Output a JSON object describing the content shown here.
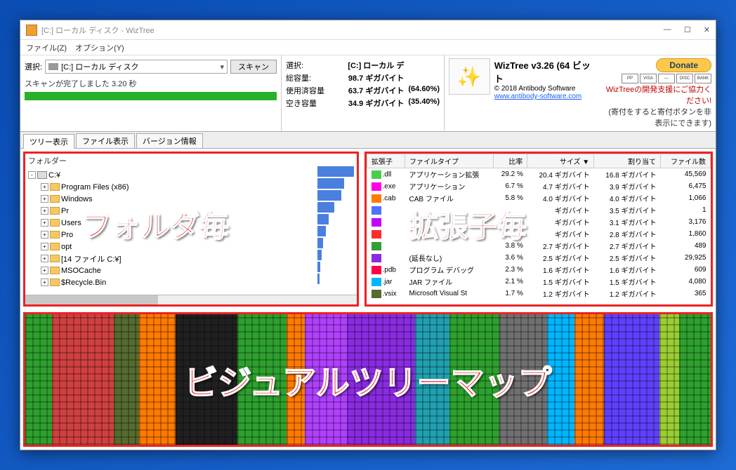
{
  "title": "[C:] ローカル ディスク  - WizTree",
  "menu": {
    "file": "ファイル(Z)",
    "options": "オプション(Y)"
  },
  "select_label": "選択:",
  "drive_combo": "[C:] ローカル ディスク",
  "scan_btn": "スキャン",
  "scan_done": "スキャンが完了しました 3.20 秒",
  "info": {
    "sel_label": "選択:",
    "sel_val": "[C:] ローカル デ",
    "total_label": "総容量:",
    "total_val": "98.7 ギガバイト",
    "used_label": "使用済容量",
    "used_val": "63.7 ギガバイト",
    "used_pct": "(64.60%)",
    "free_label": "空き容量",
    "free_val": "34.9 ギガバイト",
    "free_pct": "(35.40%)"
  },
  "brand": {
    "title": "WizTree v3.26 (64 ビット",
    "copyright": "© 2018 Antibody Software",
    "url": "www.antibody-software.com"
  },
  "donate": {
    "btn": "Donate",
    "line1": "WizTreeの開発支援にご協力ください!",
    "line2": "(寄付をすると寄付ボタンを非表示にできます)",
    "cc": [
      "PP",
      "VISA",
      "—",
      "DISC",
      "BANK"
    ]
  },
  "tabs": {
    "tree": "ツリー表示",
    "files": "ファイル表示",
    "version": "バージョン情報"
  },
  "folder_header": "フォルダー",
  "tree": [
    {
      "exp": "-",
      "icon": "drive",
      "label": "C:¥"
    },
    {
      "exp": "+",
      "icon": "folder",
      "label": "Program Files (x86)",
      "indent": 1
    },
    {
      "exp": "+",
      "icon": "folder",
      "label": "Windows",
      "indent": 1
    },
    {
      "exp": "+",
      "icon": "folder",
      "label": "Pr",
      "indent": 1
    },
    {
      "exp": "+",
      "icon": "folder",
      "label": "Users",
      "indent": 1
    },
    {
      "exp": "+",
      "icon": "folder",
      "label": "Pro",
      "indent": 1
    },
    {
      "exp": "+",
      "icon": "folder",
      "label": "opt",
      "indent": 1
    },
    {
      "exp": "+",
      "icon": "folder",
      "label": "[14 ファイル C:¥]",
      "indent": 1
    },
    {
      "exp": "+",
      "icon": "folder",
      "label": "MSOCache",
      "indent": 1
    },
    {
      "exp": "+",
      "icon": "folder",
      "label": "$Recycle.Bin",
      "indent": 1
    }
  ],
  "mini_bars": [
    52,
    38,
    34,
    24,
    16,
    12,
    8,
    6,
    4,
    3
  ],
  "ext_headers": [
    "拡張子",
    "ファイルタイプ",
    "比率",
    "サイズ ▼",
    "割り当て",
    "ファイル数"
  ],
  "ext_rows": [
    {
      "c": "#45d04a",
      "ext": ".dll",
      "type": "アプリケーション拡張",
      "pct": "29.2 %",
      "size": "20.4 ギガバイト",
      "alloc": "16.8 ギガバイト",
      "files": "45,569"
    },
    {
      "c": "#ff00e8",
      "ext": ".exe",
      "type": "アプリケーション",
      "pct": "6.7 %",
      "size": "4.7 ギガバイト",
      "alloc": "3.9 ギガバイト",
      "files": "6,475"
    },
    {
      "c": "#ff7a00",
      "ext": ".cab",
      "type": "CAB ファイル",
      "pct": "5.8 %",
      "size": "4.0 ギガバイト",
      "alloc": "4.0 ギガバイト",
      "files": "1,066"
    },
    {
      "c": "#5070ff",
      "ext": "",
      "type": "",
      "pct": "",
      "size": "ギガバイト",
      "alloc": "3.5 ギガバイト",
      "files": "1"
    },
    {
      "c": "#c000ff",
      "ext": "",
      "type": "",
      "pct": "",
      "size": "ギガバイト",
      "alloc": "3.1 ギガバイト",
      "files": "3,176"
    },
    {
      "c": "#ff2a2a",
      "ext": "",
      "type": "",
      "pct": "",
      "size": "ギガバイト",
      "alloc": "2.8 ギガバイト",
      "files": "1,860"
    },
    {
      "c": "#30a030",
      "ext": "",
      "type": "",
      "pct": "3.8 %",
      "size": "2.7 ギガバイト",
      "alloc": "2.7 ギガバイト",
      "files": "489"
    },
    {
      "c": "#8a2be2",
      "ext": "",
      "type": "(延長なし)",
      "pct": "3.6 %",
      "size": "2.5 ギガバイト",
      "alloc": "2.5 ギガバイト",
      "files": "29,925"
    },
    {
      "c": "#ff0044",
      "ext": ".pdb",
      "type": "プログラム デバッグ",
      "pct": "2.3 %",
      "size": "1.6 ギガバイト",
      "alloc": "1.6 ギガバイト",
      "files": "609"
    },
    {
      "c": "#00b7ff",
      "ext": ".jar",
      "type": "JAR ファイル",
      "pct": "2.1 %",
      "size": "1.5 ギガバイト",
      "alloc": "1.5 ギガバイト",
      "files": "4,080"
    },
    {
      "c": "#556b2f",
      "ext": ".vsix",
      "type": "Microsoft Visual St",
      "pct": "1.7 %",
      "size": "1.2 ギガバイト",
      "alloc": "1.2 ギガバイト",
      "files": "365"
    }
  ],
  "treemap_colors": [
    "#2da02d",
    "#d04040",
    "#556b2f",
    "#ff7a00",
    "#202020",
    "#2da02d",
    "#ff7a00",
    "#b040ff",
    "#8a2be2",
    "#20a0b0",
    "#2da02d",
    "#707070",
    "#00b7ff",
    "#ff7a00",
    "#6040ff",
    "#9acd32",
    "#2da02d"
  ],
  "treemap_path": "[C:¥]",
  "annotations": {
    "left": "フォルダ毎",
    "right": "拡張子毎",
    "bottom": "ビジュアルツリーマップ"
  }
}
